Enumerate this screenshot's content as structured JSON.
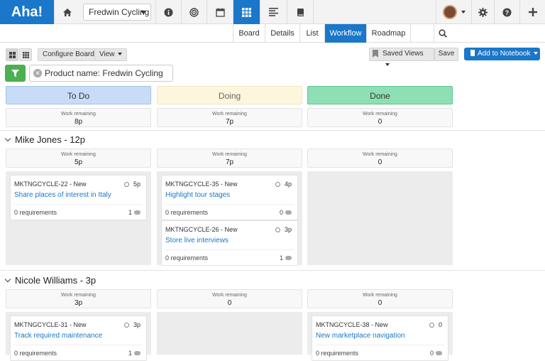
{
  "topbar": {
    "logo": "Aha!",
    "product_select": "Fredwin Cycling",
    "icons": [
      "home-icon",
      "info-icon",
      "target-icon",
      "calendar-icon",
      "grid-icon",
      "list-icon",
      "book-icon",
      "avatar",
      "gear-icon",
      "help-icon",
      "plus-icon"
    ]
  },
  "nav": {
    "tabs": [
      "Board",
      "Details",
      "List",
      "Workflow",
      "Roadmap"
    ],
    "active": "Workflow"
  },
  "toolbar": {
    "configure_board": "Configure Board",
    "view": "View",
    "saved_views": "Saved Views",
    "save": "Save",
    "add_to_notebook": "Add to Notebook"
  },
  "filter": {
    "label": "Product name: Fredwin Cycling"
  },
  "columns": [
    {
      "name": "To Do",
      "color": "#c9dcf7",
      "border": "#a3c0e8",
      "text": "#333333"
    },
    {
      "name": "Doing",
      "color": "#fdf6dc",
      "border": "#f1e6bd",
      "text": "#666666"
    },
    {
      "name": "Done",
      "color": "#8ee0b4",
      "border": "#5cc58c",
      "text": "#333333"
    }
  ],
  "work_remaining_label": "Work remaining",
  "totals": [
    "8p",
    "7p",
    "0"
  ],
  "sections": [
    {
      "title": "Mike Jones - 12p",
      "totals": [
        "5p",
        "7p",
        "0"
      ],
      "lanes": [
        [
          {
            "key": "MKTNGCYCLE-22 - New",
            "estimate": "5p",
            "title": "Share places of interest in Italy",
            "requirements": "0 requirements",
            "comments": "1"
          }
        ],
        [
          {
            "key": "MKTNGCYCLE-35 - New",
            "estimate": "4p",
            "title": "Highlight tour stages",
            "requirements": "0 requirements",
            "comments": "0"
          },
          {
            "key": "MKTNGCYCLE-26 - New",
            "estimate": "3p",
            "title": "Store live interviews",
            "requirements": "0 requirements",
            "comments": "1"
          }
        ],
        []
      ]
    },
    {
      "title": "Nicole Williams - 3p",
      "totals": [
        "3p",
        "0",
        "0"
      ],
      "lanes": [
        [
          {
            "key": "MKTNGCYCLE-31 - New",
            "estimate": "3p",
            "title": "Track required maintenance",
            "requirements": "0 requirements",
            "comments": "1"
          }
        ],
        [],
        [
          {
            "key": "MKTNGCYCLE-38 - New",
            "estimate": "0",
            "title": "New marketplace navigation",
            "requirements": "0 requirements",
            "comments": "0"
          }
        ]
      ]
    }
  ]
}
